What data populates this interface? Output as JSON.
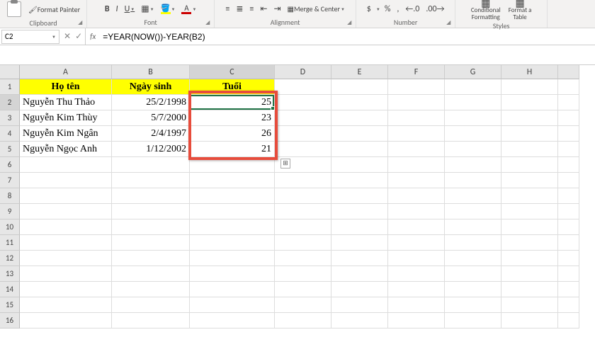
{
  "ribbon": {
    "paste_label": "Paste",
    "format_painter": "Format Painter",
    "clipboard_label": "Clipboard",
    "font_label": "Font",
    "alignment_label": "Alignment",
    "merge_center": "Merge & Center",
    "number_label": "Number",
    "currency": "$",
    "percent": "%",
    "comma": ",",
    "decimal_inc": "←.0",
    "decimal_dec": ".00→",
    "conditional": "Conditional",
    "formatting": "Formatting",
    "format_as": "Format a",
    "table": "Table",
    "styles_label": "Styles"
  },
  "namebox": {
    "value": "C2"
  },
  "formula": {
    "value": "=YEAR(NOW())-YEAR(B2)"
  },
  "columns": [
    "A",
    "B",
    "C",
    "D",
    "E",
    "F",
    "G",
    "H"
  ],
  "headers": {
    "A": "Họ tên",
    "B": "Ngày sinh",
    "C": "Tuổi"
  },
  "rows": [
    {
      "n": "1"
    },
    {
      "n": "2",
      "A": "Nguyễn Thu Thảo",
      "B": "25/2/1998",
      "C": "25"
    },
    {
      "n": "3",
      "A": "Nguyễn Kim Thùy",
      "B": "5/7/2000",
      "C": "23"
    },
    {
      "n": "4",
      "A": "Nguyễn Kim Ngân",
      "B": "2/4/1997",
      "C": "26"
    },
    {
      "n": "5",
      "A": "Nguyễn Ngọc Anh",
      "B": "1/12/2002",
      "C": "21"
    },
    {
      "n": "6"
    },
    {
      "n": "7"
    },
    {
      "n": "8"
    },
    {
      "n": "9"
    },
    {
      "n": "10"
    },
    {
      "n": "11"
    },
    {
      "n": "12"
    },
    {
      "n": "13"
    },
    {
      "n": "14"
    },
    {
      "n": "15"
    },
    {
      "n": "16"
    }
  ]
}
